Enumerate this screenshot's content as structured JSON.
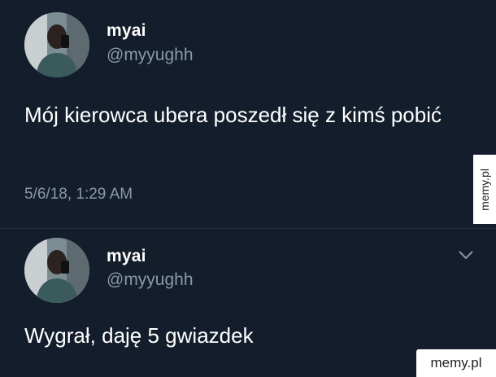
{
  "tweet": {
    "display_name": "myai",
    "handle": "@myyughh",
    "text": "Mój kierowca ubera poszedł się z kimś pobić",
    "timestamp": "5/6/18, 1:29 AM",
    "avatar_icon": "profile-photo"
  },
  "reply": {
    "display_name": "myai",
    "handle": "@myyughh",
    "text": "Wygrał, daję 5 gwiazdek",
    "menu_icon": "chevron-down-icon",
    "avatar_icon": "profile-photo"
  },
  "watermarks": {
    "side": "memy.pl",
    "corner": "memy.pl"
  },
  "colors": {
    "background": "#141d2b",
    "text_primary": "#ffffff",
    "text_secondary": "#8899a6"
  }
}
